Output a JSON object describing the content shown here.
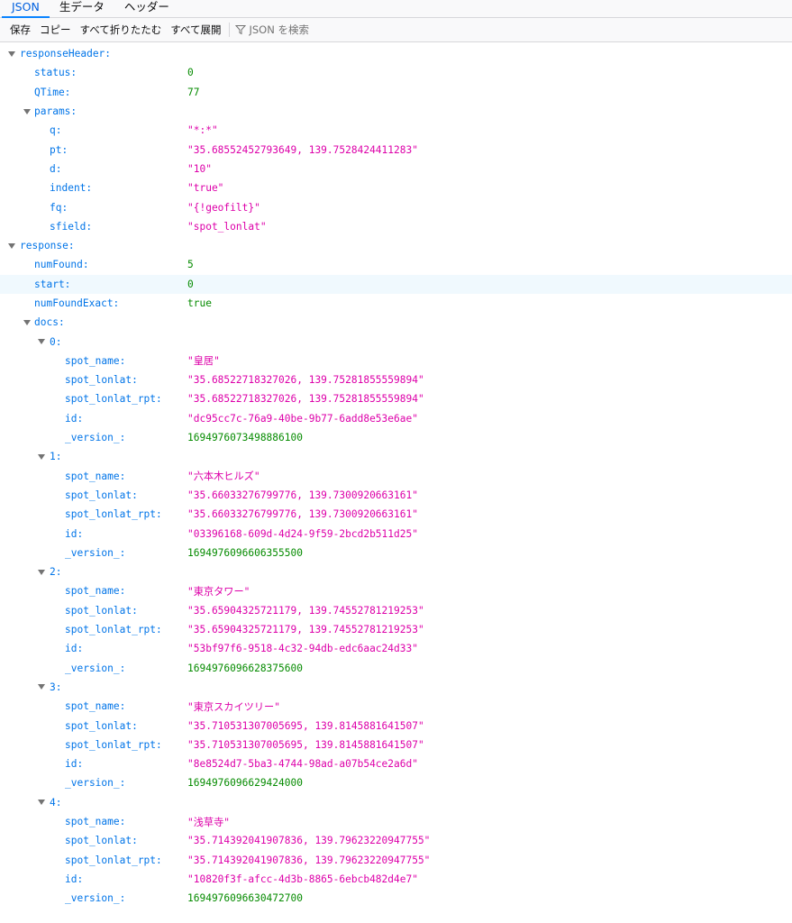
{
  "tabs": [
    {
      "label": "JSON",
      "active": true
    },
    {
      "label": "生データ",
      "active": false
    },
    {
      "label": "ヘッダー",
      "active": false
    }
  ],
  "toolbar": {
    "save": "保存",
    "copy": "コピー",
    "collapse_all": "すべて折りたたむ",
    "expand_all": "すべて展開",
    "filter_placeholder": "JSON を検索"
  },
  "rows": [
    {
      "indent": 0,
      "key": "responseHeader:",
      "type": "node",
      "expanded": true
    },
    {
      "indent": 1,
      "key": "status:",
      "value": "0",
      "type": "number"
    },
    {
      "indent": 1,
      "key": "QTime:",
      "value": "77",
      "type": "number"
    },
    {
      "indent": 1,
      "key": "params:",
      "type": "node",
      "expanded": true
    },
    {
      "indent": 2,
      "key": "q:",
      "value": "\"*:*\"",
      "type": "string"
    },
    {
      "indent": 2,
      "key": "pt:",
      "value": "\"35.68552452793649, 139.7528424411283\"",
      "type": "string"
    },
    {
      "indent": 2,
      "key": "d:",
      "value": "\"10\"",
      "type": "string"
    },
    {
      "indent": 2,
      "key": "indent:",
      "value": "\"true\"",
      "type": "string"
    },
    {
      "indent": 2,
      "key": "fq:",
      "value": "\"{!geofilt}\"",
      "type": "string"
    },
    {
      "indent": 2,
      "key": "sfield:",
      "value": "\"spot_lonlat\"",
      "type": "string"
    },
    {
      "indent": 0,
      "key": "response:",
      "type": "node",
      "expanded": true
    },
    {
      "indent": 1,
      "key": "numFound:",
      "value": "5",
      "type": "number"
    },
    {
      "indent": 1,
      "key": "start:",
      "value": "0",
      "type": "number",
      "highlight": true
    },
    {
      "indent": 1,
      "key": "numFoundExact:",
      "value": "true",
      "type": "bool"
    },
    {
      "indent": 1,
      "key": "docs:",
      "type": "node",
      "expanded": true
    },
    {
      "indent": 2,
      "key": "0:",
      "type": "node",
      "expanded": true
    },
    {
      "indent": 3,
      "key": "spot_name:",
      "value": "\"皇居\"",
      "type": "string"
    },
    {
      "indent": 3,
      "key": "spot_lonlat:",
      "value": "\"35.68522718327026, 139.75281855559894\"",
      "type": "string"
    },
    {
      "indent": 3,
      "key": "spot_lonlat_rpt:",
      "value": "\"35.68522718327026, 139.75281855559894\"",
      "type": "string"
    },
    {
      "indent": 3,
      "key": "id:",
      "value": "\"dc95cc7c-76a9-40be-9b77-6add8e53e6ae\"",
      "type": "string"
    },
    {
      "indent": 3,
      "key": "_version_:",
      "value": "1694976073498886100",
      "type": "number"
    },
    {
      "indent": 2,
      "key": "1:",
      "type": "node",
      "expanded": true
    },
    {
      "indent": 3,
      "key": "spot_name:",
      "value": "\"六本木ヒルズ\"",
      "type": "string"
    },
    {
      "indent": 3,
      "key": "spot_lonlat:",
      "value": "\"35.66033276799776, 139.7300920663161\"",
      "type": "string"
    },
    {
      "indent": 3,
      "key": "spot_lonlat_rpt:",
      "value": "\"35.66033276799776, 139.7300920663161\"",
      "type": "string"
    },
    {
      "indent": 3,
      "key": "id:",
      "value": "\"03396168-609d-4d24-9f59-2bcd2b511d25\"",
      "type": "string"
    },
    {
      "indent": 3,
      "key": "_version_:",
      "value": "1694976096606355500",
      "type": "number"
    },
    {
      "indent": 2,
      "key": "2:",
      "type": "node",
      "expanded": true
    },
    {
      "indent": 3,
      "key": "spot_name:",
      "value": "\"東京タワー\"",
      "type": "string"
    },
    {
      "indent": 3,
      "key": "spot_lonlat:",
      "value": "\"35.65904325721179, 139.74552781219253\"",
      "type": "string"
    },
    {
      "indent": 3,
      "key": "spot_lonlat_rpt:",
      "value": "\"35.65904325721179, 139.74552781219253\"",
      "type": "string"
    },
    {
      "indent": 3,
      "key": "id:",
      "value": "\"53bf97f6-9518-4c32-94db-edc6aac24d33\"",
      "type": "string"
    },
    {
      "indent": 3,
      "key": "_version_:",
      "value": "1694976096628375600",
      "type": "number"
    },
    {
      "indent": 2,
      "key": "3:",
      "type": "node",
      "expanded": true
    },
    {
      "indent": 3,
      "key": "spot_name:",
      "value": "\"東京スカイツリー\"",
      "type": "string"
    },
    {
      "indent": 3,
      "key": "spot_lonlat:",
      "value": "\"35.710531307005695, 139.8145881641507\"",
      "type": "string"
    },
    {
      "indent": 3,
      "key": "spot_lonlat_rpt:",
      "value": "\"35.710531307005695, 139.8145881641507\"",
      "type": "string"
    },
    {
      "indent": 3,
      "key": "id:",
      "value": "\"8e8524d7-5ba3-4744-98ad-a07b54ce2a6d\"",
      "type": "string"
    },
    {
      "indent": 3,
      "key": "_version_:",
      "value": "1694976096629424000",
      "type": "number"
    },
    {
      "indent": 2,
      "key": "4:",
      "type": "node",
      "expanded": true
    },
    {
      "indent": 3,
      "key": "spot_name:",
      "value": "\"浅草寺\"",
      "type": "string"
    },
    {
      "indent": 3,
      "key": "spot_lonlat:",
      "value": "\"35.714392041907836, 139.79623220947755\"",
      "type": "string"
    },
    {
      "indent": 3,
      "key": "spot_lonlat_rpt:",
      "value": "\"35.714392041907836, 139.79623220947755\"",
      "type": "string"
    },
    {
      "indent": 3,
      "key": "id:",
      "value": "\"10820f3f-afcc-4d3b-8865-6ebcb482d4e7\"",
      "type": "string"
    },
    {
      "indent": 3,
      "key": "_version_:",
      "value": "1694976096630472700",
      "type": "number"
    }
  ]
}
